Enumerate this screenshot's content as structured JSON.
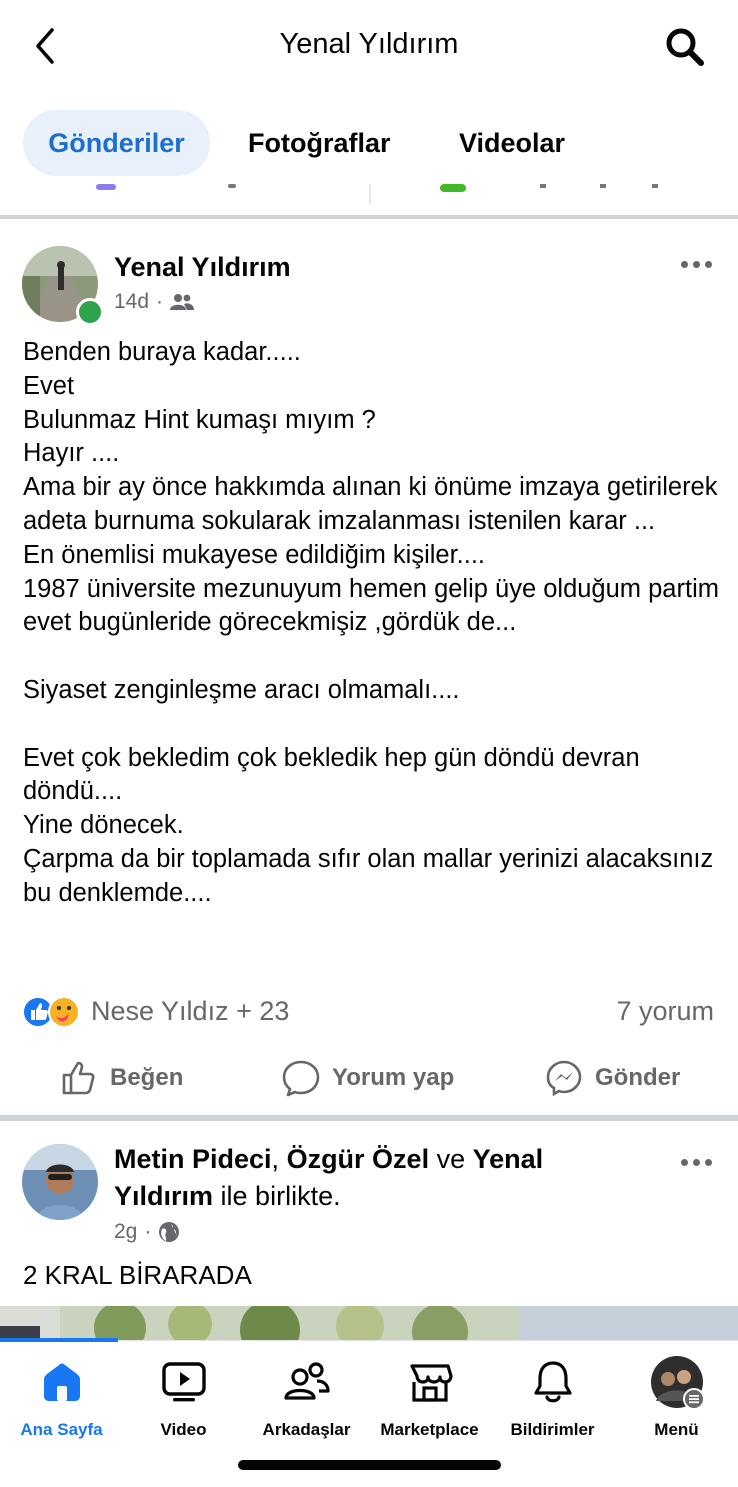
{
  "header": {
    "title": "Yenal Yıldırım",
    "back_icon": "chevron-left-icon",
    "search_icon": "search-icon"
  },
  "tabs": [
    {
      "label": "Gönderiler",
      "active": true
    },
    {
      "label": "Fotoğraflar",
      "active": false
    },
    {
      "label": "Videolar",
      "active": false
    }
  ],
  "post1": {
    "author": "Yenal Yıldırım",
    "time": "14d",
    "audience_icon": "friends-icon",
    "online": true,
    "body": "Benden buraya kadar.....\nEvet\nBulunmaz Hint kumaşı mıyım ?\nHayır ....\nAma bir ay önce hakkımda alınan ki önüme imzaya getirilerek adeta burnuma sokularak imzalanması istenilen karar ...\nEn önemlisi mukayese edildiğim kişiler....\n1987 üniversite mezunuyum hemen gelip üye olduğum partim evet bugünleride görecekmişiz ,gördük de...\n\nSiyaset zenginleşme aracı olmamalı....\n\nEvet çok bekledim çok bekledik hep gün döndü devran döndü....\nYine dönecek.\nÇarpma da bir toplamada sıfır olan mallar yerinizi alacaksınız bu denklemde....",
    "reactions_text": "Nese Yıldız + 23",
    "reaction_icons": [
      "like-icon",
      "care-icon"
    ],
    "comments": "7 yorum",
    "actions": {
      "like": "Beğen",
      "comment": "Yorum yap",
      "send": "Gönder"
    }
  },
  "post2": {
    "name1": "Metin Pideci",
    "sep1": ",",
    "name2": "Özgür Özel",
    "and": "ve",
    "name3": "Yenal",
    "name3b": "Yıldırım",
    "with_text": "ile birlikte.",
    "time": "2g",
    "audience_icon": "globe-icon",
    "text": "2 KRAL BİRARADA"
  },
  "nav": {
    "items": [
      {
        "label": "Ana Sayfa",
        "icon": "home-icon",
        "active": true
      },
      {
        "label": "Video",
        "icon": "video-icon",
        "active": false
      },
      {
        "label": "Arkadaşlar",
        "icon": "friends-icon",
        "active": false
      },
      {
        "label": "Marketplace",
        "icon": "store-icon",
        "active": false
      },
      {
        "label": "Bildirimler",
        "icon": "bell-icon",
        "active": false
      },
      {
        "label": "Menü",
        "icon": "menu-avatar-icon",
        "active": false
      }
    ]
  },
  "colors": {
    "accent": "#1877f2",
    "tab_active_bg": "#e7f0fb",
    "secondary_text": "#65676b",
    "online": "#31a24c"
  }
}
